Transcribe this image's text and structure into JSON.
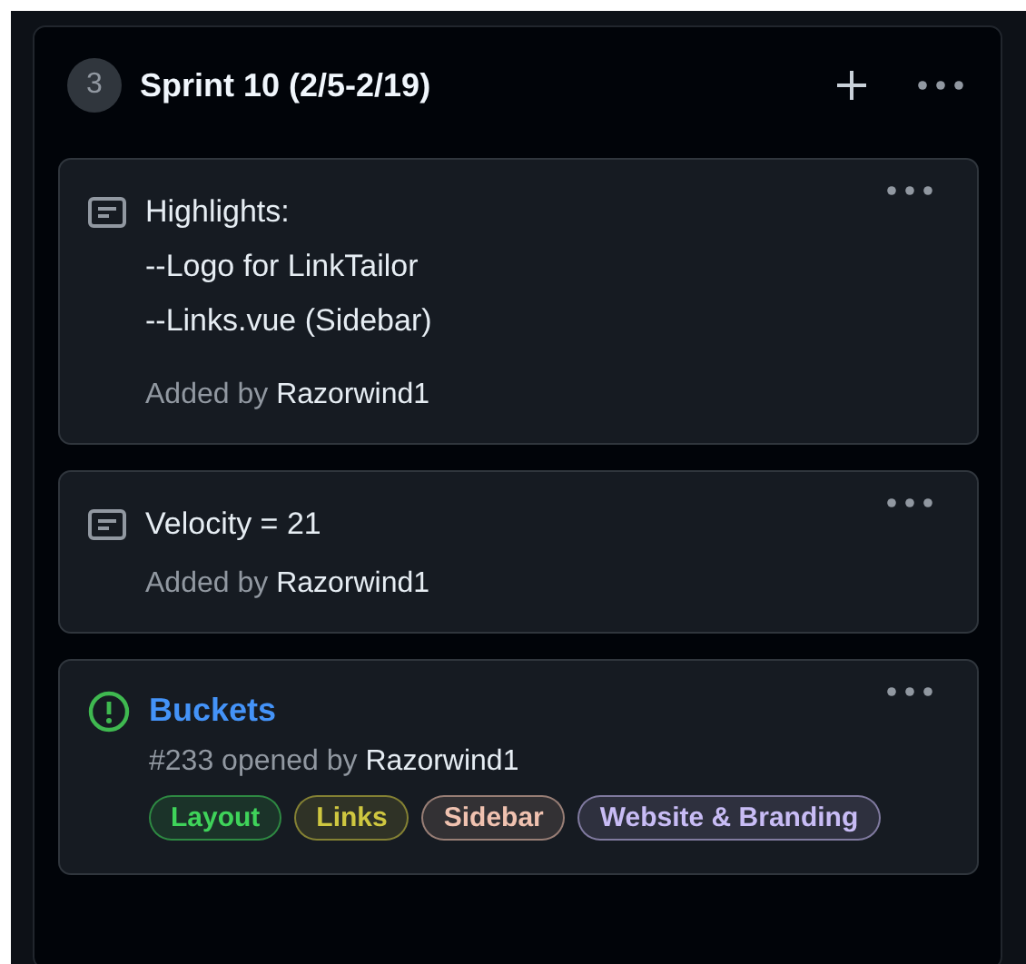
{
  "column": {
    "count": "3",
    "title": "Sprint 10 (2/5-2/19)",
    "cards": [
      {
        "kind": "note",
        "lines": [
          "Highlights:",
          "--Logo for LinkTailor",
          "--Links.vue (Sidebar)"
        ],
        "meta": "Added by",
        "author": "Razorwind1"
      },
      {
        "kind": "note",
        "lines": [
          "Velocity = 21"
        ],
        "meta": "Added by",
        "author": "Razorwind1"
      },
      {
        "kind": "issue",
        "title": "Buckets",
        "meta": "#233 opened by",
        "author": "Razorwind1",
        "labels": [
          {
            "text": "Layout",
            "color": "#3fd35a"
          },
          {
            "text": "Links",
            "color": "#cfc740"
          },
          {
            "text": "Sidebar",
            "color": "#f0c2b0"
          },
          {
            "text": "Website & Branding",
            "color": "#c8bcf5"
          }
        ]
      }
    ]
  }
}
